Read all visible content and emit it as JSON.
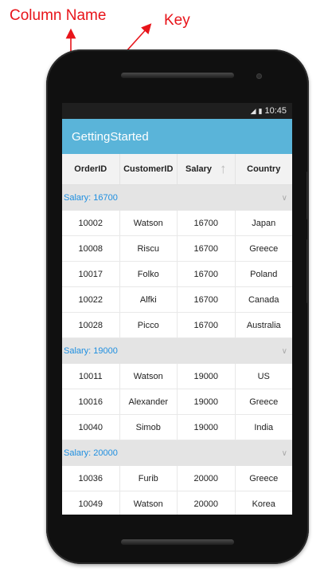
{
  "annotations": {
    "column_name": "Column Name",
    "key": "Key"
  },
  "statusbar": {
    "time": "10:45"
  },
  "appbar": {
    "title": "GettingStarted"
  },
  "grid": {
    "columns": [
      "OrderID",
      "CustomerID",
      "Salary",
      "Country"
    ],
    "sorted_column": "Salary",
    "sort_direction": "ascending",
    "groups": [
      {
        "label": "Salary: 16700",
        "rows": [
          [
            "10002",
            "Watson",
            "16700",
            "Japan"
          ],
          [
            "10008",
            "Riscu",
            "16700",
            "Greece"
          ],
          [
            "10017",
            "Folko",
            "16700",
            "Poland"
          ],
          [
            "10022",
            "Alfki",
            "16700",
            "Canada"
          ],
          [
            "10028",
            "Picco",
            "16700",
            "Australia"
          ]
        ]
      },
      {
        "label": "Salary: 19000",
        "rows": [
          [
            "10011",
            "Watson",
            "19000",
            "US"
          ],
          [
            "10016",
            "Alexander",
            "19000",
            "Greece"
          ],
          [
            "10040",
            "Simob",
            "19000",
            "India"
          ]
        ]
      },
      {
        "label": "Salary: 20000",
        "rows": [
          [
            "10036",
            "Furib",
            "20000",
            "Greece"
          ],
          [
            "10049",
            "Watson",
            "20000",
            "Korea"
          ]
        ]
      }
    ]
  },
  "colors": {
    "annotation": "#e8141a",
    "appbar": "#5ab4d9",
    "group_label": "#1f8fe0",
    "group_background": "#e4e4e4"
  }
}
